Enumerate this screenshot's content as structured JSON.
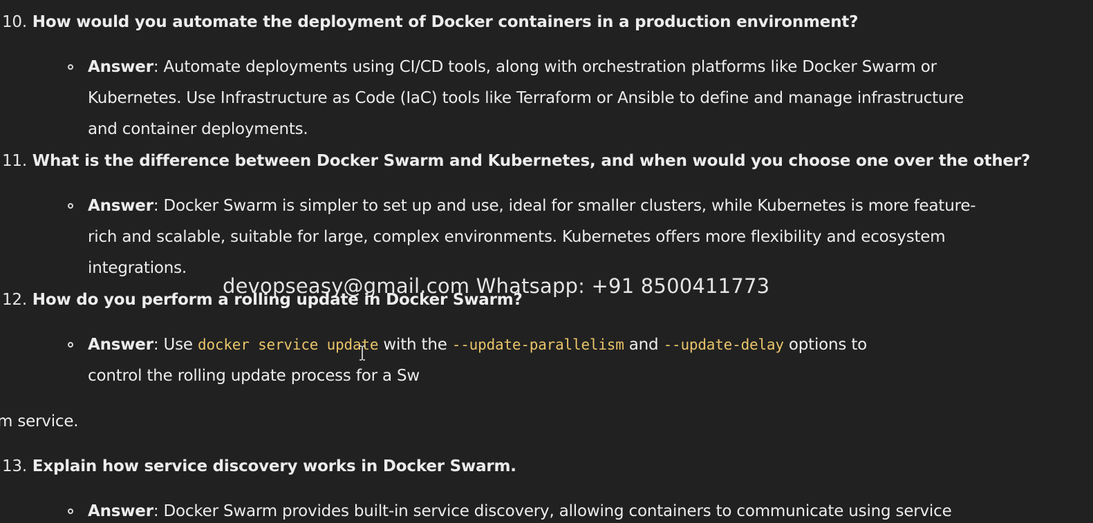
{
  "q10": {
    "num": "10.",
    "text": "How would you automate the deployment of Docker containers in a production environment?",
    "answer_label": "Answer",
    "lines": [
      ": Automate deployments using CI/CD tools, along with orchestration platforms like Docker Swarm or",
      "Kubernetes. Use Infrastructure as Code (IaC) tools like Terraform or Ansible to define and manage infrastructure",
      "and container deployments."
    ]
  },
  "q11": {
    "num": "11.",
    "text": "What is the difference between Docker Swarm and Kubernetes, and when would you choose one over the other?",
    "answer_label": "Answer",
    "lines": [
      ": Docker Swarm is simpler to set up and use, ideal for smaller clusters, while Kubernetes is more feature-",
      "rich and scalable, suitable for large, complex environments. Kubernetes offers more flexibility and ecosystem",
      "integrations."
    ]
  },
  "q12": {
    "num": "12.",
    "text": "How do you perform a rolling update in Docker Swarm?",
    "answer_label": "Answer",
    "line1_prefix": ": Use ",
    "code1": "docker service update",
    "line1_mid1": " with the ",
    "code2": "--update-parallelism",
    "line1_mid2": " and ",
    "code3": "--update-delay",
    "line1_suffix": " options to",
    "line2": "control the rolling update process for a Sw",
    "line3": "m service."
  },
  "q13": {
    "num": "13.",
    "text": "Explain how service discovery works in Docker Swarm.",
    "answer_label": "Answer",
    "line1": ": Docker Swarm provides built-in service discovery, allowing containers to communicate using service"
  },
  "watermark": "devopseasy@gmail.com Whatsapp: +91 8500411773",
  "icons": {
    "cursor": "text-cursor-icon",
    "bullet": "hollow-circle-bullet-icon"
  },
  "colors": {
    "background": "#212121",
    "text": "#ececec",
    "code": "#e9c46a"
  }
}
